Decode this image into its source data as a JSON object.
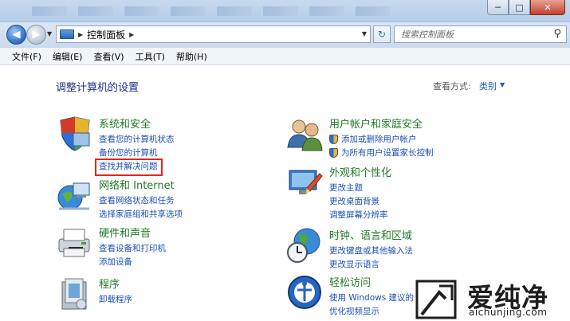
{
  "window": {
    "controls": {
      "minimize": "─",
      "maximize": "□",
      "close": "✕"
    }
  },
  "address_bar": {
    "back_icon": "arrow-left-icon",
    "forward_icon": "arrow-right-icon",
    "path": "控制面板",
    "search_placeholder": "搜索控制面板"
  },
  "menu": [
    "文件(F)",
    "编辑(E)",
    "查看(V)",
    "工具(T)",
    "帮助(H)"
  ],
  "page": {
    "title": "调整计算机的设置",
    "view_by_label": "查看方式:",
    "view_by_value": "类别"
  },
  "categories": [
    {
      "title": "系统和安全",
      "icon": "shield-computer-icon",
      "links": [
        "查看您的计算机状态",
        "备份您的计算机",
        "查找并解决问题"
      ]
    },
    {
      "title": "网络和 Internet",
      "icon": "network-globe-icon",
      "links": [
        "查看网络状态和任务",
        "选择家庭组和共享选项"
      ]
    },
    {
      "title": "硬件和声音",
      "icon": "printer-icon",
      "links": [
        "查看设备和打印机",
        "添加设备"
      ]
    },
    {
      "title": "程序",
      "icon": "programs-icon",
      "links": [
        "卸载程序"
      ]
    },
    {
      "title": "用户帐户和家庭安全",
      "icon": "users-icon",
      "links": [
        "添加或删除用户帐户",
        "为所有用户设置家长控制"
      ]
    },
    {
      "title": "外观和个性化",
      "icon": "display-paint-icon",
      "links": [
        "更改主题",
        "更改桌面背景",
        "调整屏幕分辨率"
      ]
    },
    {
      "title": "时钟、语言和区域",
      "icon": "globe-clock-icon",
      "links": [
        "更改键盘或其他输入法",
        "更改显示语言"
      ]
    },
    {
      "title": "轻松访问",
      "icon": "ease-of-access-icon",
      "links": [
        "使用 Windows 建议的",
        "优化视频显示"
      ]
    }
  ],
  "watermark": {
    "text": "爱纯净",
    "url": "aichunjing.com"
  }
}
